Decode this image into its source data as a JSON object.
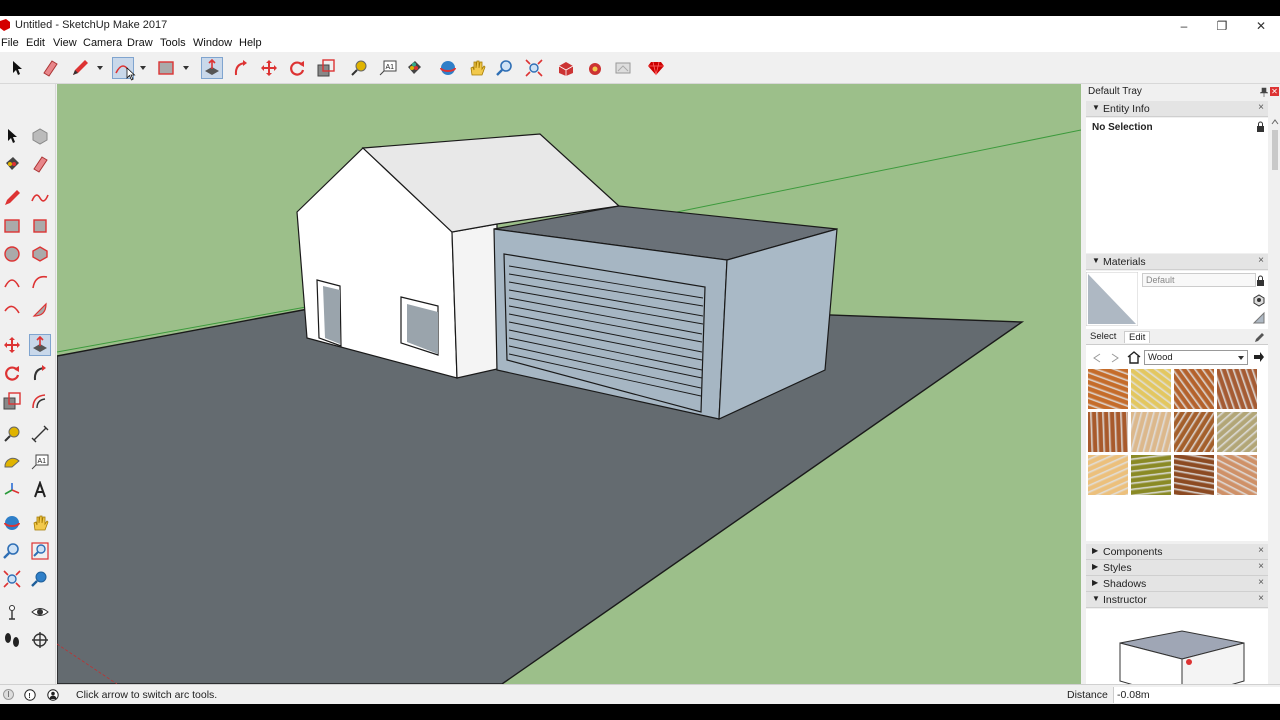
{
  "window": {
    "title": "Untitled - SketchUp Make 2017"
  },
  "menu": [
    "File",
    "Edit",
    "View",
    "Camera",
    "Draw",
    "Tools",
    "Window",
    "Help"
  ],
  "status": {
    "message": "Click arrow to switch arc tools.",
    "measure_label": "Distance",
    "measure_value": "-0.08m"
  },
  "tray": {
    "title": "Default Tray",
    "entity_info": {
      "header": "Entity Info",
      "selection": "No Selection"
    },
    "materials": {
      "header": "Materials",
      "material_name": "Default",
      "tabs": [
        "Select",
        "Edit"
      ],
      "library": "Wood",
      "swatch_colors": [
        "#c56c2a",
        "#e3c760",
        "#b4622c",
        "#a55b33",
        "#a85a2c",
        "#dcb88c",
        "#a45f2b",
        "#b2a677",
        "#ecc07c",
        "#8a8a25",
        "#8c4a22",
        "#cf9168"
      ]
    },
    "collapsed_sections": [
      "Components",
      "Styles",
      "Shadows"
    ],
    "instructor": {
      "header": "Instructor"
    }
  },
  "colors": {
    "sky": "#9cbf8a",
    "ground": "#646b70",
    "wall": "#ffffff",
    "garage": "#a6b6c3",
    "roof_dark": "#6a7178",
    "accent": "#d40000"
  }
}
